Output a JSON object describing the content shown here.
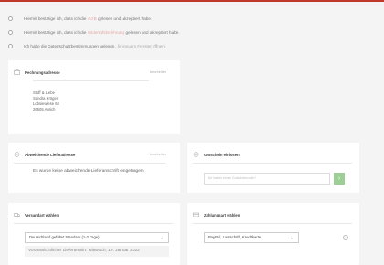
{
  "consents": [
    {
      "prefix": "Hiermit bestätige ich, dass ich die",
      "link": "AGB",
      "suffix": "gelesen und akzeptiert habe."
    },
    {
      "prefix": "Hiermit bestätige ich, dass ich die",
      "link": "Widerrufsbelehrung",
      "suffix": "gelesen und akzeptiert habe."
    },
    {
      "prefix": "Ich habe die Datenschutzbestimmungen gelesen.",
      "link": "",
      "suffix": "",
      "note": "(in neuem Fenster öffnen)"
    }
  ],
  "billing": {
    "title": "Rechnungsadresse",
    "edit": "bearbeiten",
    "lines": [
      "Stoff & Liebe",
      "Sandra Kröger",
      "Lobsiewiese 64",
      "26605 Aurich"
    ]
  },
  "shipping": {
    "title": "Abweichende Lieferadresse",
    "edit": "bearbeiten",
    "message": "Es wurde keine abweichende Lieferanschrift eingetragen."
  },
  "voucher": {
    "title": "Gutschein einlösen",
    "placeholder": "Sie haben einen Gutscheincode?",
    "button": "›"
  },
  "versand": {
    "title": "Versandart wählen",
    "selected": "Deutschland gefaltet Standard (1-2 Tage)",
    "delivery": "Voraussichtlicher Liefertermin: Mittwoch, 19. Januar 2022"
  },
  "zahlung": {
    "title": "Zahlungsart wählen",
    "selected": "PayPal, Lastschrift, Kreditkarte",
    "info": "i"
  },
  "colors": {
    "accent_bar": "#c0392b",
    "link": "#e3a9a5",
    "voucher_button": "#9ccf93"
  }
}
